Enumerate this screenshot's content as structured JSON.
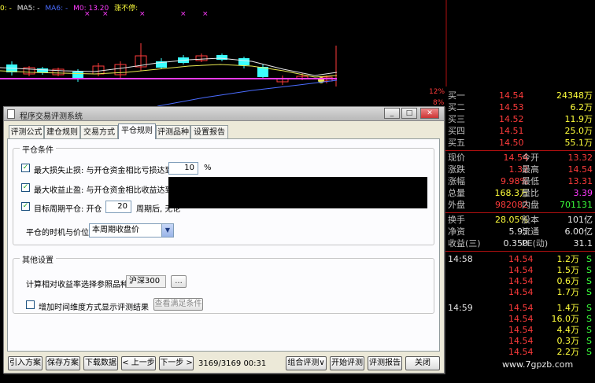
{
  "chart": {
    "legend_prefix": "0: -",
    "ma5_label": "MA5: -",
    "ma_blue_label": "MA6: -",
    "m0_label": "M0: 13.20",
    "limit_label": "涨不停:",
    "pct_labels": [
      "12%",
      "8%",
      "4%"
    ],
    "colors": {
      "up": "#ff3b3b",
      "down": "#3bffff",
      "ma_white": "#e8e8e8",
      "ma_yellow": "#e8e850",
      "ma_magenta": "#ff3bff",
      "ma_blue": "#4a6cff"
    }
  },
  "quote": {
    "asks": [
      {
        "label": "买一",
        "price": "14.54",
        "vol": "24348万"
      },
      {
        "label": "买二",
        "price": "14.53",
        "vol": "6.2万"
      },
      {
        "label": "买三",
        "price": "14.52",
        "vol": "11.9万"
      },
      {
        "label": "买四",
        "price": "14.51",
        "vol": "25.0万"
      },
      {
        "label": "买五",
        "price": "14.50",
        "vol": "55.1万"
      }
    ],
    "stats": [
      {
        "l1": "现价",
        "v1": "14.54",
        "l2": "今开",
        "v2": "13.32",
        "c1": "red",
        "c2": "red"
      },
      {
        "l1": "涨跌",
        "v1": "1.32",
        "l2": "最高",
        "v2": "14.54",
        "c1": "red",
        "c2": "red"
      },
      {
        "l1": "涨幅",
        "v1": "9.98%",
        "l2": "最低",
        "v2": "13.31",
        "c1": "red",
        "c2": "red"
      },
      {
        "l1": "总量",
        "v1": "168.3万",
        "l2": "量比",
        "v2": "3.39",
        "c1": "yel",
        "c2": "mag"
      },
      {
        "l1": "外盘",
        "v1": "982082",
        "l2": "内盘",
        "v2": "701131",
        "c1": "red",
        "c2": "grn"
      }
    ],
    "stats2": [
      {
        "l1": "换手",
        "v1": "28.05%",
        "l2": "股本",
        "v2": "101亿",
        "c1": "yel",
        "c2": "wht"
      },
      {
        "l1": "净资",
        "v1": "5.95",
        "l2": "流通",
        "v2": "6.00亿",
        "c1": "wht",
        "c2": "wht"
      },
      {
        "l1": "收益(三)",
        "v1": "0.350",
        "l2": "PE(动)",
        "v2": "31.1",
        "c1": "wht",
        "c2": "wht"
      }
    ],
    "ticks": [
      {
        "time": "14:58",
        "price": "14.54",
        "vol": "1.2万",
        "dir": "S"
      },
      {
        "time": "",
        "price": "14.54",
        "vol": "1.5万",
        "dir": "S"
      },
      {
        "time": "",
        "price": "14.54",
        "vol": "0.6万",
        "dir": "S"
      },
      {
        "time": "",
        "price": "14.54",
        "vol": "1.7万",
        "dir": "S"
      },
      {
        "time": "14:59",
        "price": "14.54",
        "vol": "1.4万",
        "dir": "S"
      },
      {
        "time": "",
        "price": "14.54",
        "vol": "16.0万",
        "dir": "S"
      },
      {
        "time": "",
        "price": "14.54",
        "vol": "4.4万",
        "dir": "S"
      },
      {
        "time": "",
        "price": "14.54",
        "vol": "0.3万",
        "dir": "S"
      },
      {
        "time": "",
        "price": "14.54",
        "vol": "2.2万",
        "dir": "S"
      }
    ],
    "watermark": "www.7gpzb.com"
  },
  "dialog": {
    "title": "程序交易评测系统",
    "min_label": "_",
    "max_label": "□",
    "close_label": "✕",
    "tabs": [
      "评测公式",
      "建仓规则",
      "交易方式",
      "平仓规则",
      "评测品种",
      "设置报告"
    ],
    "active_tab": 3,
    "close_group": {
      "title": "平仓条件",
      "stop_loss_label": "最大损失止损:  与开仓资金相比亏损达到",
      "stop_loss_value": "10",
      "stop_loss_unit": "%",
      "take_profit_label": "最大收益止盈:  与开仓资金相比收益达到",
      "period_label": "目标周期平仓:   开仓",
      "period_value": "20",
      "period_suffix": "周期后, 无论",
      "timing_label": "平仓的时机与价位",
      "timing_value": "本周期收盘价",
      "dropdown_arrow": "▼"
    },
    "other_group": {
      "title": "其他设置",
      "benchmark_label": "计算相对收益率选择参照品种",
      "benchmark_value": "沪深300",
      "browse_label": "...",
      "time_dim_label": "增加时间维度方式显示评测结果",
      "view_button": "查看满足条件"
    },
    "check_mark": "✓",
    "buttons": {
      "import": "引入方案",
      "save": "保存方案",
      "download": "下载数据",
      "prev": "< 上一步",
      "next": "下一步 >",
      "combo": "组合评测∨",
      "start": "开始评测",
      "report": "评测报告",
      "close": "关闭"
    },
    "progress_text": "3169/3169  00:31"
  }
}
